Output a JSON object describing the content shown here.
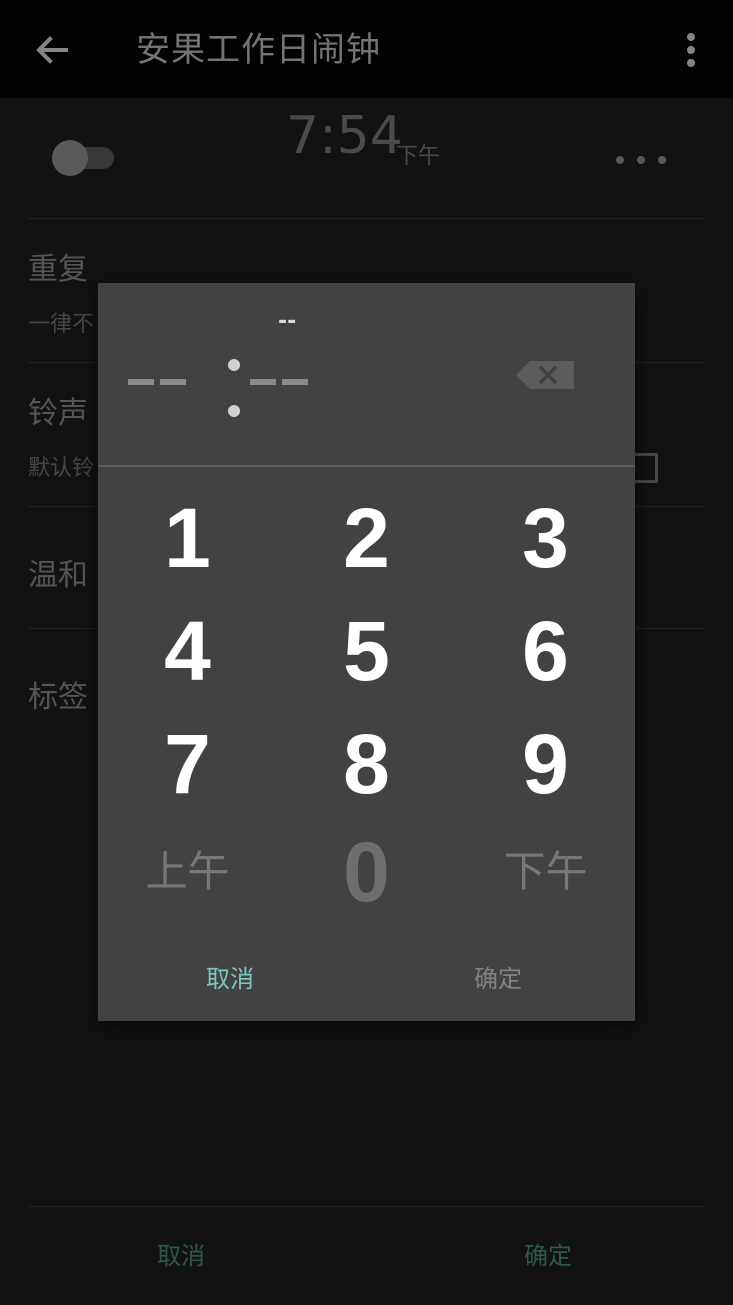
{
  "appbar": {
    "title": "安果工作日闹钟",
    "back_icon": "arrow-back-icon",
    "menu_icon": "more-vert-icon"
  },
  "alarm": {
    "time": "7:54",
    "ampm": "下午",
    "enabled": false,
    "more_icon": "more-horiz-icon"
  },
  "settings": {
    "repeat": {
      "title": "重复",
      "value": "一律不"
    },
    "ringtone": {
      "title": "铃声",
      "value": "默认铃"
    },
    "gentle": {
      "title": "温和"
    },
    "label": {
      "title": "标签"
    }
  },
  "bottom_bar": {
    "cancel": "取消",
    "confirm": "确定"
  },
  "dialog": {
    "ampm_indicator": "--",
    "backspace_icon": "backspace-icon",
    "keys": {
      "k1": "1",
      "k2": "2",
      "k3": "3",
      "k4": "4",
      "k5": "5",
      "k6": "6",
      "k7": "7",
      "k8": "8",
      "k9": "9",
      "am": "上午",
      "k0": "0",
      "pm": "下午"
    },
    "cancel": "取消",
    "confirm": "确定"
  },
  "colors": {
    "dialog_bg": "#424242",
    "accent": "#7dc7bb",
    "screen_bg": "#131313"
  }
}
